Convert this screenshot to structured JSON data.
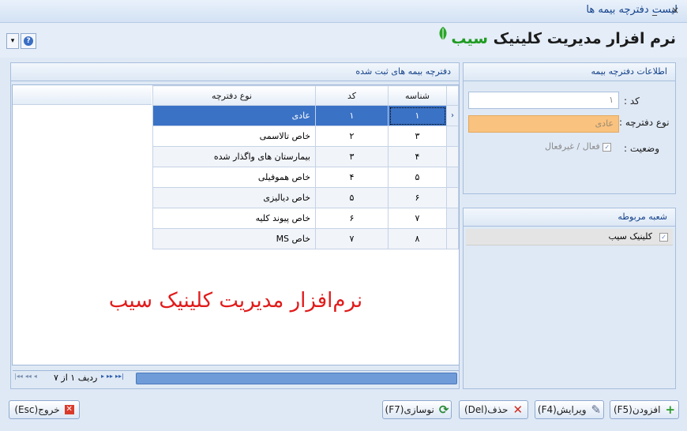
{
  "window": {
    "title": "لیست دفترچه بیمه ها",
    "minimize": "_",
    "close": "×"
  },
  "logo": {
    "part1": "نرم افزار مدیریت کلینیک",
    "part2": "سیب"
  },
  "help": {
    "dropdown": "▾",
    "icon": "?"
  },
  "grid_panel": {
    "title": "دفترچه بیمه های ثبت شده",
    "columns": {
      "id": "شناسه",
      "code": "کد",
      "type": "نوع دفترچه"
    },
    "rows": [
      {
        "id": "۱",
        "code": "۱",
        "type": "عادی"
      },
      {
        "id": "۳",
        "code": "۲",
        "type": "خاص تالاسمی"
      },
      {
        "id": "۴",
        "code": "۳",
        "type": "بیمارستان های واگذار شده"
      },
      {
        "id": "۵",
        "code": "۴",
        "type": "خاص هموفیلی"
      },
      {
        "id": "۶",
        "code": "۵",
        "type": "خاص دیالیزی"
      },
      {
        "id": "۷",
        "code": "۶",
        "type": "خاص پیوند کلیه"
      },
      {
        "id": "۸",
        "code": "۷",
        "type": "خاص MS"
      }
    ],
    "selected_indicator": "›",
    "watermark": "نرم‌افزار مدیریت کلینیک سیب",
    "navigator": {
      "record_text": "ردیف ۱ از ۷",
      "first": "|◂◂",
      "prev": "◂◂",
      "prev1": "◂",
      "next1": "▸",
      "next": "▸▸",
      "last": "▸▸|"
    }
  },
  "info_panel": {
    "title": "اطلاعات دفترچه بیمه",
    "code_label": "کد :",
    "code_value": "۱",
    "type_label": "نوع دفترچه :",
    "type_value": "عادی",
    "status_label": "وضعیت :",
    "status_text": "فعال / غیرفعال",
    "status_checked": "✓"
  },
  "branch_panel": {
    "title": "شعبه مربوطه",
    "items": [
      {
        "label": "کلینیک سیب",
        "checked": "✓"
      }
    ]
  },
  "buttons": {
    "add": "افزودن(F5)",
    "edit": "ویرایش(F4)",
    "delete": "حذف(Del)",
    "refresh": "نوسازی(F7)",
    "exit": "خروج(Esc)",
    "add_icon": "+",
    "edit_icon": "✎",
    "delete_icon": "✕",
    "refresh_icon": "⟳",
    "exit_icon": "✕"
  }
}
